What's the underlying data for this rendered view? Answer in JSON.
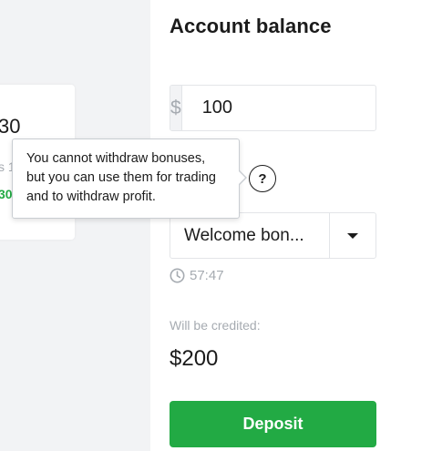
{
  "header": {
    "title": "Account balance"
  },
  "amount": {
    "currency_symbol": "$",
    "value": "100"
  },
  "help": {
    "icon_label": "?"
  },
  "tooltip": {
    "text": "You cannot withdraw bonuses, but you can use them for trading and to withdraw profit."
  },
  "bonus": {
    "selected": "Welcome bon..."
  },
  "timer": {
    "value": "57:47"
  },
  "credited": {
    "label": "Will be credited:",
    "amount": "$200"
  },
  "deposit": {
    "label": "Deposit"
  },
  "left_card": {
    "number": "30",
    "grey_text": "s 1",
    "green_text": "30"
  },
  "colors": {
    "accent_green": "#22aa44",
    "muted_text": "#a6abb1",
    "background": "#f2f3f5"
  }
}
